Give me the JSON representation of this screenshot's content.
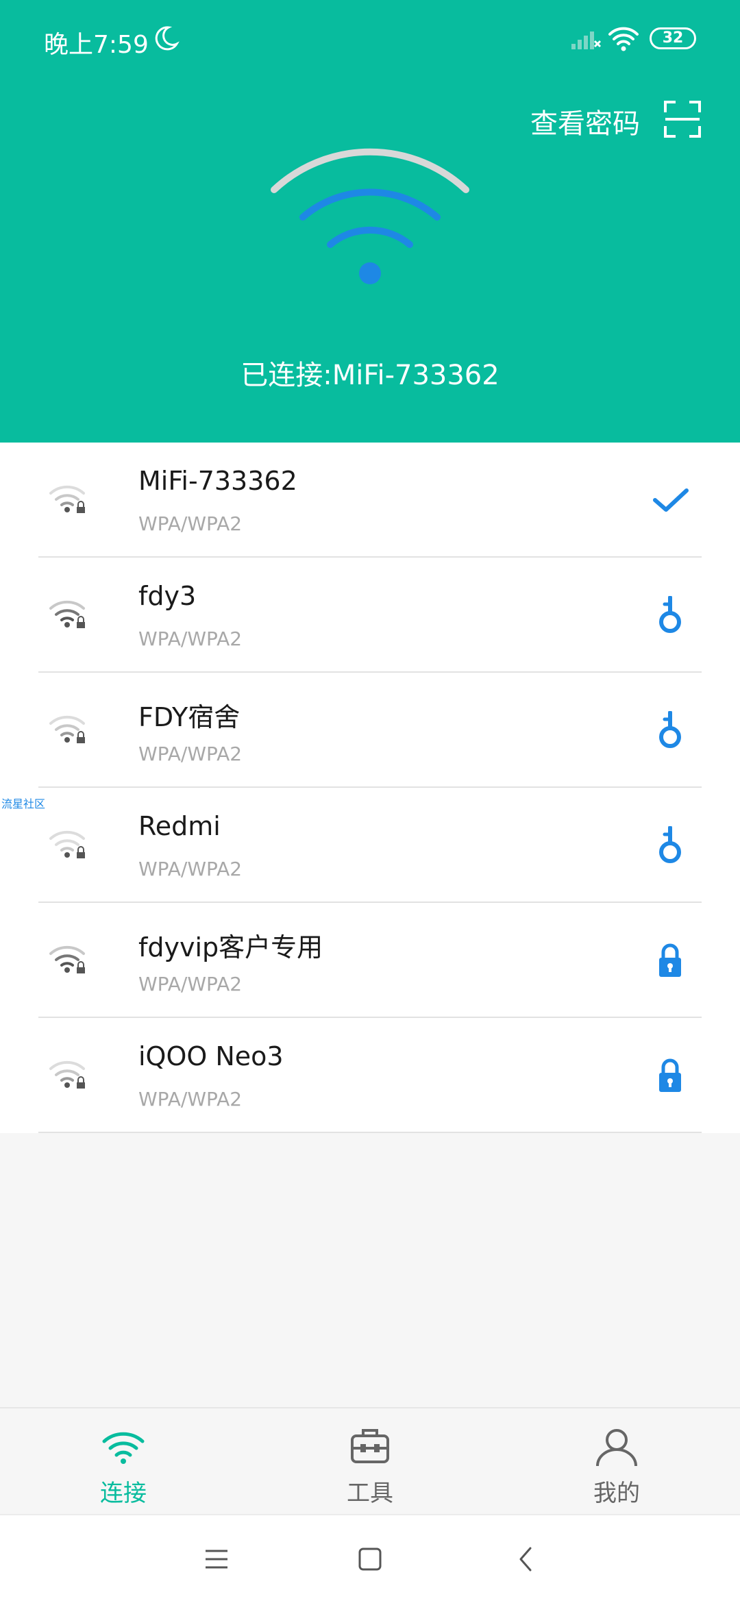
{
  "status_bar": {
    "time": "晚上7:59",
    "battery": "32"
  },
  "header": {
    "view_password": "查看密码",
    "connected_text": "已连接:MiFi-733362"
  },
  "networks": [
    {
      "name": "MiFi-733362",
      "security": "WPA/WPA2",
      "action_icon": "check-icon"
    },
    {
      "name": "fdy3",
      "security": "WPA/WPA2",
      "action_icon": "key-icon"
    },
    {
      "name": "FDY宿舍",
      "security": "WPA/WPA2",
      "action_icon": "key-icon"
    },
    {
      "name": "Redmi",
      "security": "WPA/WPA2",
      "action_icon": "key-icon"
    },
    {
      "name": "fdyvip客户专用",
      "security": "WPA/WPA2",
      "action_icon": "lock-icon"
    },
    {
      "name": "iQOO Neo3",
      "security": "WPA/WPA2",
      "action_icon": "lock-icon"
    }
  ],
  "watermark": "流星社区",
  "tabs": [
    {
      "label": "连接",
      "icon": "wifi-icon",
      "active": true
    },
    {
      "label": "工具",
      "icon": "toolbox-icon",
      "active": false
    },
    {
      "label": "我的",
      "icon": "person-icon",
      "active": false
    }
  ],
  "colors": {
    "primary": "#08bc9e",
    "accent": "#1e88e5",
    "active_tab": "#08bc9e",
    "inactive_tab": "#666666"
  }
}
